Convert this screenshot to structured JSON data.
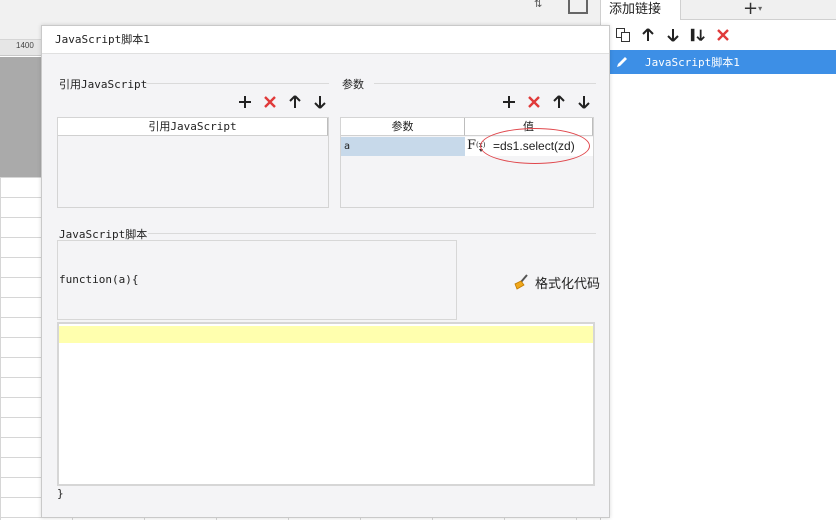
{
  "background": {
    "ruler_value": "1400"
  },
  "right_panel": {
    "tab_label": "添加链接",
    "add_symbol": "+",
    "add_caret": "▾",
    "items": [
      {
        "label": "JavaScript脚本1",
        "selected": true
      }
    ]
  },
  "dialog": {
    "title": "JavaScript脚本1",
    "ref_section": {
      "title": "引用JavaScript",
      "column_header": "引用JavaScript",
      "rows": []
    },
    "params_section": {
      "title": "参数",
      "columns": [
        "参数",
        "值"
      ],
      "rows": [
        {
          "name": "a",
          "fx_label": "F",
          "fx_sub": "(x)",
          "value": "=ds1.select(zd)"
        }
      ]
    },
    "script_section": {
      "title": "JavaScript脚本",
      "function_signature": "function(a){",
      "format_button_label": "格式化代码",
      "closing": "}"
    }
  },
  "colors": {
    "selection_blue": "#3d8fe6",
    "delete_red": "#e03a3a",
    "annotation_red": "#e0474c",
    "param_cell_blue": "#c7d9ea",
    "editor_highlight": "#ffffae"
  }
}
